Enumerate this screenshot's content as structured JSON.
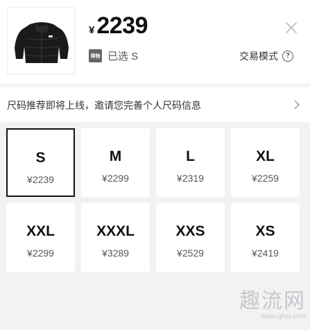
{
  "header": {
    "currency": "¥",
    "price": "2239",
    "selected_label": "已选 S",
    "badge_text": "得物",
    "trade_mode_label": "交易模式",
    "help_glyph": "?",
    "close_icon": "close-icon"
  },
  "banner": {
    "text": "尺码推荐即将上线，邀请您完善个人尺码信息"
  },
  "sizes": [
    {
      "size": "S",
      "price": "¥2239",
      "selected": true
    },
    {
      "size": "M",
      "price": "¥2299",
      "selected": false
    },
    {
      "size": "L",
      "price": "¥2319",
      "selected": false
    },
    {
      "size": "XL",
      "price": "¥2259",
      "selected": false
    },
    {
      "size": "XXL",
      "price": "¥2299",
      "selected": false
    },
    {
      "size": "XXXL",
      "price": "¥3289",
      "selected": false
    },
    {
      "size": "XXS",
      "price": "¥2529",
      "selected": false
    },
    {
      "size": "XS",
      "price": "¥2419",
      "selected": false
    }
  ],
  "watermark": {
    "big": "趣流网",
    "small": "www.qfuu.com"
  },
  "colors": {
    "selected_border": "#111111",
    "cell_bg": "#ffffff",
    "page_bg": "#f2f2f4"
  }
}
